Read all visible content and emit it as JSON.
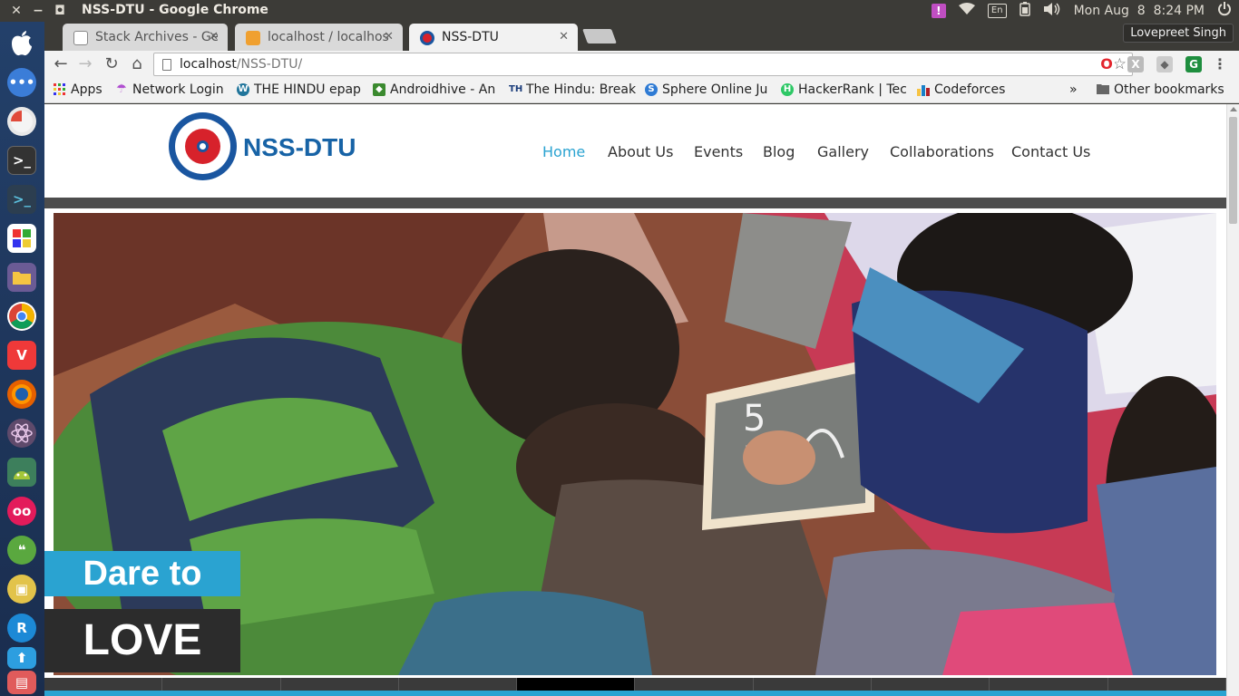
{
  "os": {
    "window_title": "NSS-DTU - Google Chrome",
    "keyboard_layout": "En",
    "datetime": "Mon Aug  8  8:24 PM",
    "alert_glyph": "!"
  },
  "launcher_apps": [
    "apple-logo",
    "dash",
    "disk",
    "terminal",
    "terminal-2",
    "app-grid",
    "files",
    "chrome",
    "vivaldi",
    "firefox",
    "atom",
    "android-studio",
    "flickr",
    "hangouts",
    "image-viewer",
    "refresh-app",
    "store",
    "archive"
  ],
  "chrome": {
    "profile_name": "Lovepreet Singh",
    "tabs": [
      {
        "label": "Stack Archives - Gee",
        "active": false
      },
      {
        "label": "localhost / localhos",
        "active": false
      },
      {
        "label": "NSS-DTU",
        "active": true
      }
    ],
    "url_host": "localhost",
    "url_path": "/NSS-DTU/",
    "bookmarks": [
      {
        "label": "Apps"
      },
      {
        "label": "Network Login"
      },
      {
        "label": "THE HINDU epap"
      },
      {
        "label": "Androidhive - An"
      },
      {
        "label": "The Hindu: Break"
      },
      {
        "label": "Sphere Online Ju"
      },
      {
        "label": "HackerRank | Tec"
      },
      {
        "label": "Codeforces"
      }
    ],
    "bookmarks_overflow": "»",
    "other_bookmarks": "Other bookmarks"
  },
  "site": {
    "brand": "NSS-DTU",
    "nav": [
      {
        "label": "Home",
        "active": true
      },
      {
        "label": "About Us",
        "active": false
      },
      {
        "label": "Events",
        "active": false
      },
      {
        "label": "Blog",
        "active": false
      },
      {
        "label": "Gallery",
        "active": false
      },
      {
        "label": "Collaborations",
        "active": false
      },
      {
        "label": "Contact Us",
        "active": false
      }
    ],
    "slogan_line1": "Dare to",
    "slogan_line2": "LOVE",
    "slider_active_index": 4,
    "slider_count": 10
  },
  "colors": {
    "accent": "#2aa3d1",
    "brand_blue": "#1763a6",
    "header_bar": "#4d4d4d"
  }
}
